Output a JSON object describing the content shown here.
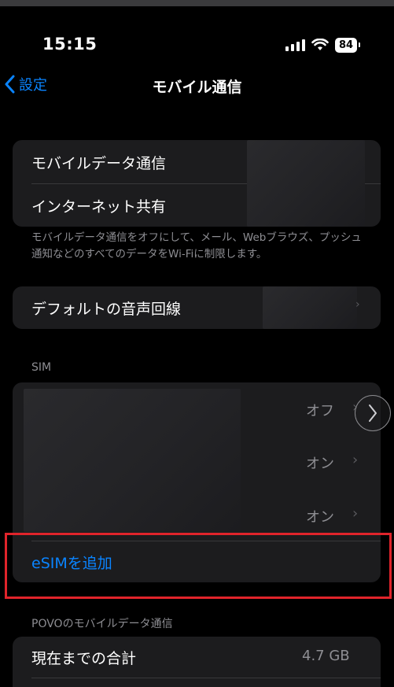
{
  "status_bar": {
    "time": "15:15",
    "battery": "84"
  },
  "nav": {
    "back_label": "設定",
    "title": "モバイル通信"
  },
  "group1": {
    "items": [
      {
        "label": "モバイルデータ通信"
      },
      {
        "label": "インターネット共有"
      }
    ]
  },
  "footer_note": "モバイルデータ通信をオフにして、メール、Webブラウズ、プッシュ通知などのすべてのデータをWi-Fiに制限します。",
  "group2": {
    "label": "デフォルトの音声回線"
  },
  "sim_section": {
    "header": "SIM",
    "lines": [
      {
        "value": "オフ"
      },
      {
        "value": "オン"
      },
      {
        "value": "オン"
      }
    ],
    "add_esim_label": "eSIMを追加"
  },
  "usage_section": {
    "header": "POVOのモバイルデータ通信",
    "total_label": "現在までの合計",
    "total_value": "4.7 GB"
  },
  "colors": {
    "accent": "#0a84ff",
    "highlight": "#e0242b"
  },
  "icons": [
    "chevron-left-icon",
    "signal-icon",
    "wifi-icon",
    "battery-icon",
    "chevron-right-icon"
  ]
}
